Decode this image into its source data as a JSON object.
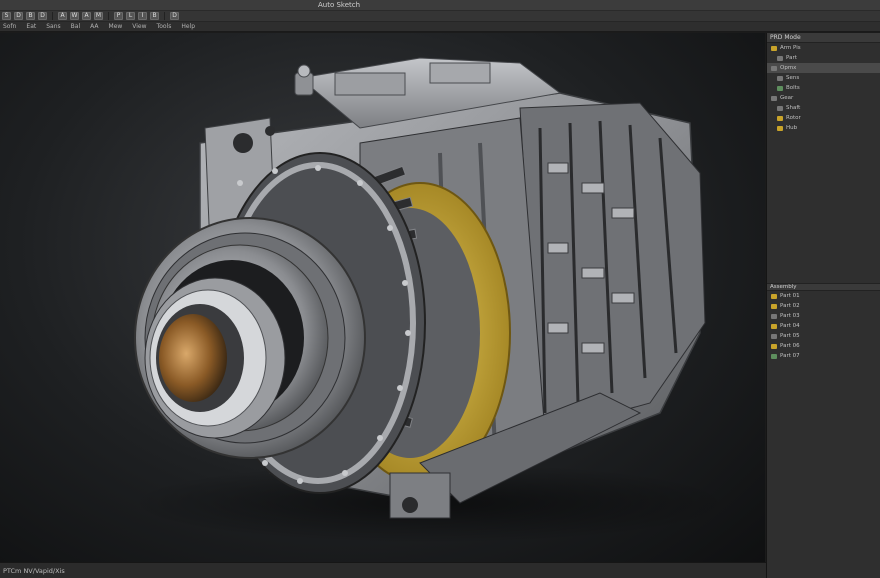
{
  "window": {
    "title": "Auto Sketch"
  },
  "toolbar": {
    "buttons": [
      "S",
      "D",
      "B",
      "D",
      "A",
      "W",
      "A",
      "M",
      "P",
      "L",
      "I",
      "B",
      "D"
    ]
  },
  "menubar": {
    "items": [
      "Sofn",
      "Eat",
      "Sans",
      "Bal",
      "AA",
      "Mew",
      "View",
      "Tools",
      "Help"
    ]
  },
  "panel": {
    "tab": "PRD Mode",
    "rows": [
      {
        "label": "Arm Pis",
        "icon": "y",
        "indent": false,
        "selected": false
      },
      {
        "label": "Part",
        "icon": "n",
        "indent": true,
        "selected": false
      },
      {
        "label": "Opmx",
        "icon": "n",
        "indent": false,
        "selected": true
      },
      {
        "label": "Sens",
        "icon": "n",
        "indent": true,
        "selected": false
      },
      {
        "label": "Bolts",
        "icon": "g",
        "indent": true,
        "selected": false
      },
      {
        "label": "Gear",
        "icon": "n",
        "indent": false,
        "selected": false
      },
      {
        "label": "Shaft",
        "icon": "n",
        "indent": true,
        "selected": false
      },
      {
        "label": "Rotor",
        "icon": "y",
        "indent": true,
        "selected": false
      },
      {
        "label": "Hub",
        "icon": "y",
        "indent": true,
        "selected": false
      }
    ],
    "sub_tab": "Assembly",
    "lower_rows": [
      {
        "label": "Part 01",
        "icon": "y"
      },
      {
        "label": "Part 02",
        "icon": "y"
      },
      {
        "label": "Part 03",
        "icon": "n"
      },
      {
        "label": "Part 04",
        "icon": "y"
      },
      {
        "label": "Part 05",
        "icon": "n"
      },
      {
        "label": "Part 06",
        "icon": "y"
      },
      {
        "label": "Part 07",
        "icon": "g"
      }
    ]
  },
  "status": {
    "text": "PTCm NV/Vapid/Xis"
  },
  "colors": {
    "housing": "#8a8c90",
    "ring": "#c9a42a",
    "bronze": "#b07a3a",
    "bg": "#1e2022"
  }
}
